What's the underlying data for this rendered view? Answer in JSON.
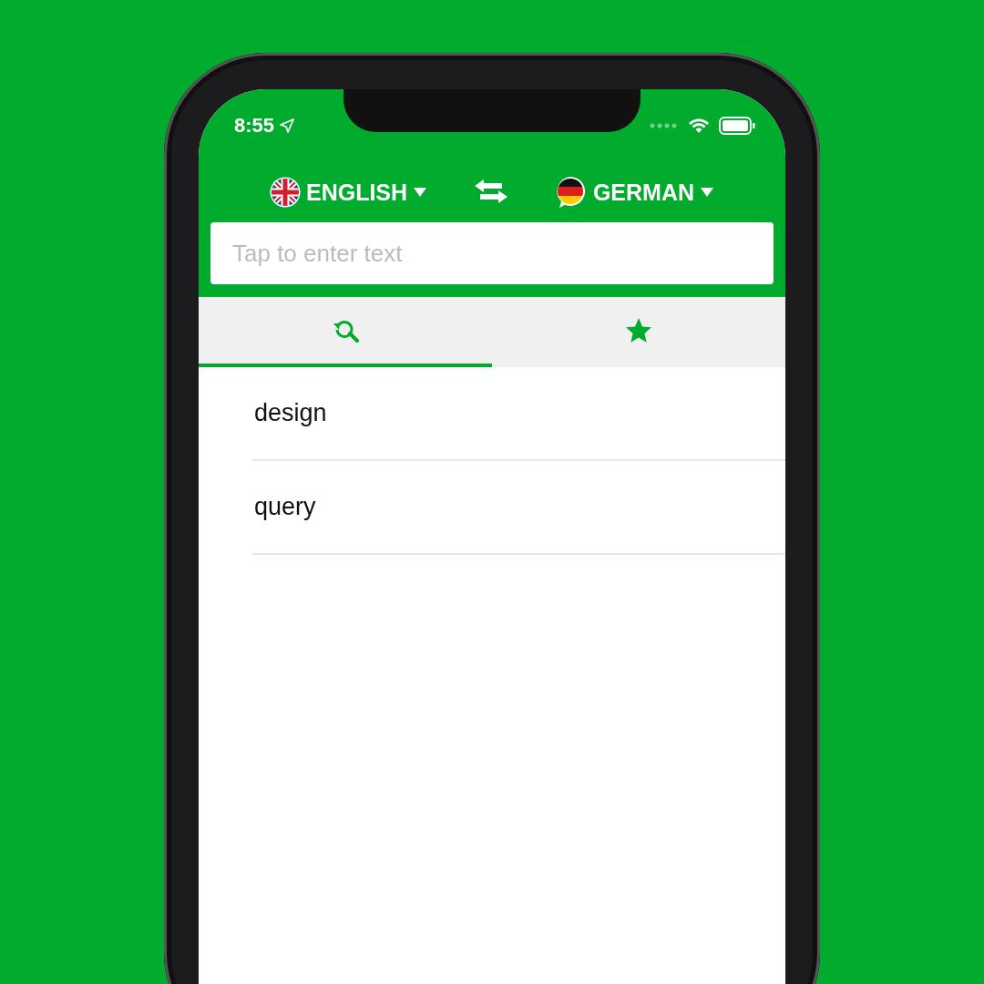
{
  "status_bar": {
    "time": "8:55"
  },
  "languages": {
    "source": "ENGLISH",
    "target": "GERMAN"
  },
  "input": {
    "placeholder": "Tap to enter text"
  },
  "tabs": [
    {
      "kind": "history",
      "selected": true
    },
    {
      "kind": "favorites",
      "selected": false
    }
  ],
  "results": [
    {
      "text": "design"
    },
    {
      "text": "query"
    }
  ]
}
